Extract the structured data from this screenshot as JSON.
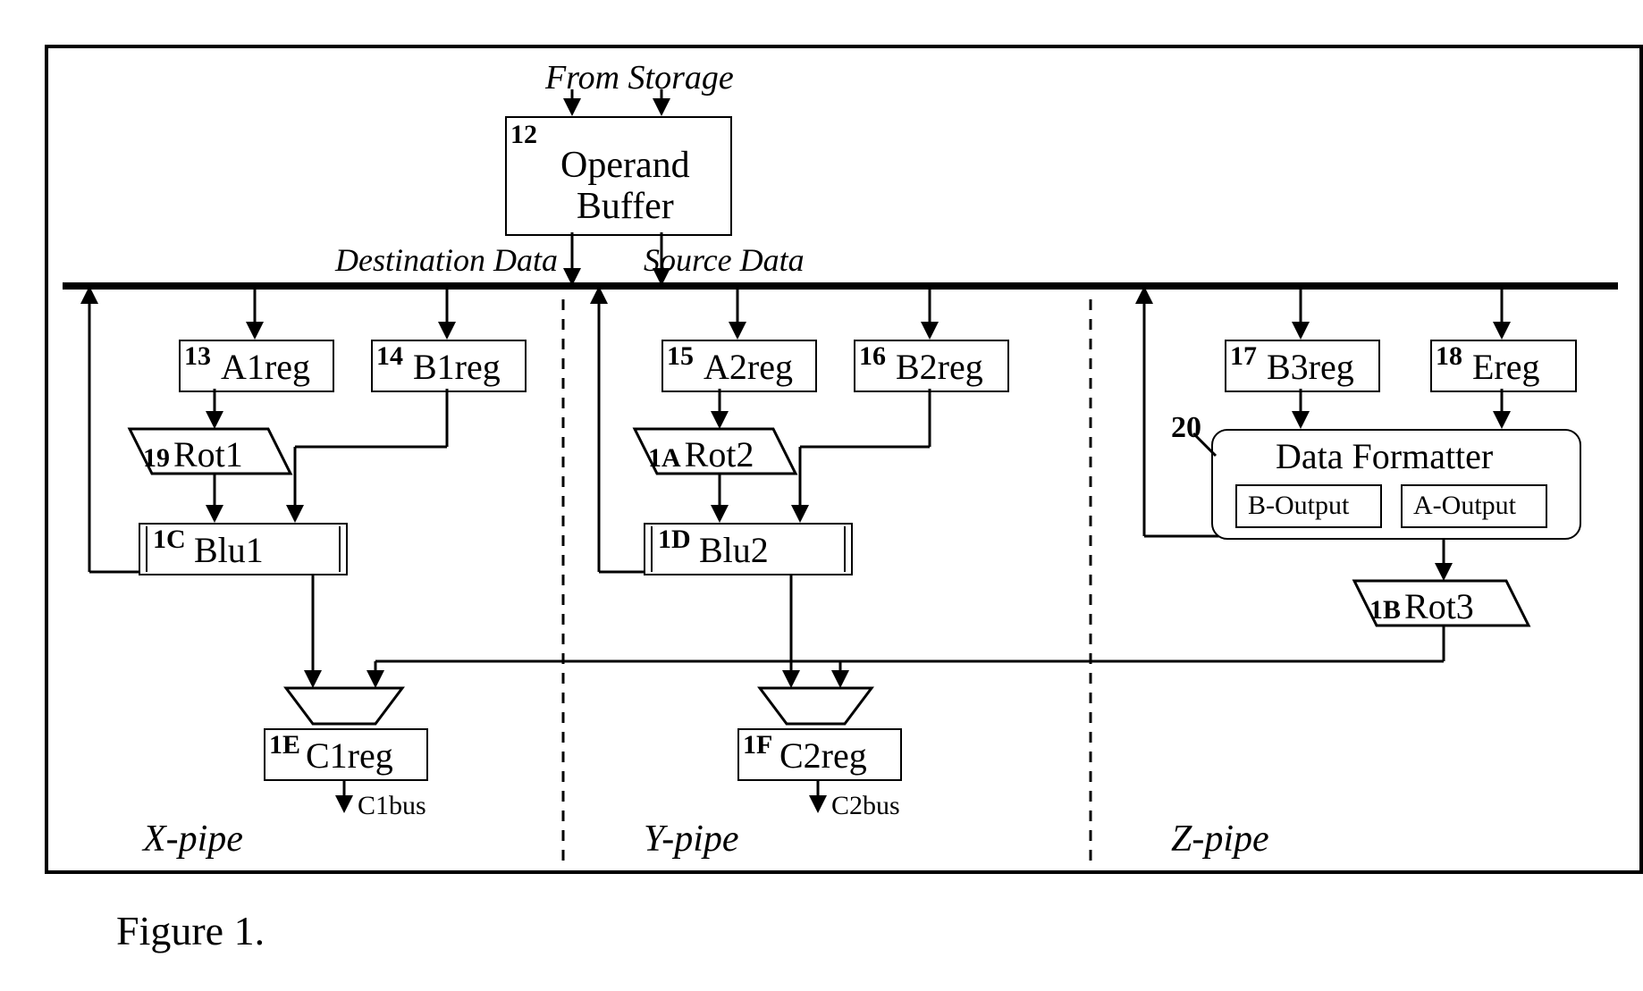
{
  "header": {
    "from_storage": "From Storage",
    "dest_data": "Destination Data",
    "source_data": "Source Data"
  },
  "blocks": {
    "operand_buffer": {
      "id": "12",
      "name": "Operand\nBuffer"
    },
    "a1reg": {
      "id": "13",
      "name": "A1reg"
    },
    "b1reg": {
      "id": "14",
      "name": "B1reg"
    },
    "a2reg": {
      "id": "15",
      "name": "A2reg"
    },
    "b2reg": {
      "id": "16",
      "name": "B2reg"
    },
    "b3reg": {
      "id": "17",
      "name": "B3reg"
    },
    "ereg": {
      "id": "18",
      "name": "Ereg"
    },
    "rot1": {
      "id": "19",
      "name": "Rot1"
    },
    "rot2": {
      "id": "1A",
      "name": "Rot2"
    },
    "rot3": {
      "id": "1B",
      "name": "Rot3"
    },
    "blu1": {
      "id": "1C",
      "name": "Blu1"
    },
    "blu2": {
      "id": "1D",
      "name": "Blu2"
    },
    "c1reg": {
      "id": "1E",
      "name": "C1reg"
    },
    "c2reg": {
      "id": "1F",
      "name": "C2reg"
    },
    "data_formatter": {
      "id": "20",
      "name": "Data Formatter",
      "b_out": "B-Output",
      "a_out": "A-Output"
    }
  },
  "pipes": {
    "x": "X-pipe",
    "y": "Y-pipe",
    "z": "Z-pipe"
  },
  "buses": {
    "c1": "C1bus",
    "c2": "C2bus"
  },
  "figure": "Figure 1."
}
